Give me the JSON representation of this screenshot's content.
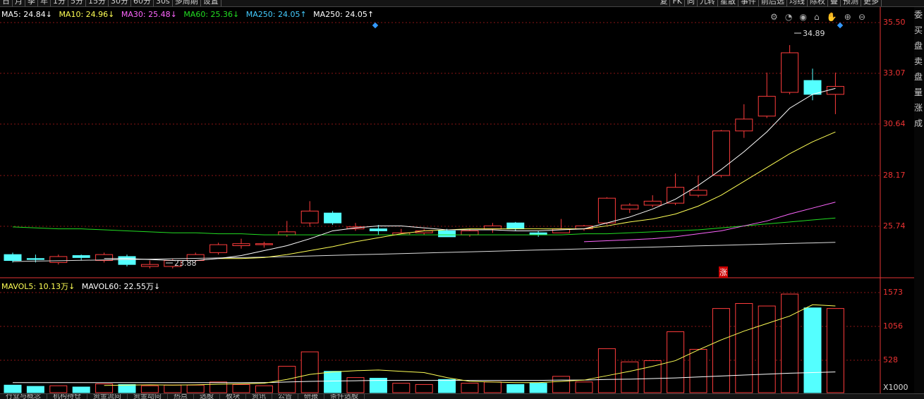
{
  "topbar": {
    "left_tabs": [
      "日",
      "月",
      "季",
      "年",
      "1分",
      "5分",
      "15分",
      "30分",
      "60分",
      "30s",
      "多周期",
      "设置"
    ],
    "right_tabs": [
      "复",
      "FK",
      "同",
      "九转",
      "星散",
      "事件",
      "前后选",
      "均线",
      "除权",
      "叠",
      "预测",
      "更多"
    ]
  },
  "ma_legend": {
    "ma5": "MA5: 24.84↓",
    "ma10": "MA10: 24.96↓",
    "ma30": "MA30: 25.48↓",
    "ma60": "MA60: 25.36↓",
    "ma250a": "MA250: 24.05↑",
    "ma250b": "MA250: 24.05↑"
  },
  "vol_legend": {
    "mavol5": "MAVOL5: 10.13万↓",
    "mavol60": "MAVOL60: 22.55万↓"
  },
  "axis": {
    "price_ticks": [
      "35.50",
      "33.07",
      "30.64",
      "28.17",
      "25.74"
    ],
    "vol_ticks": [
      "1573",
      "1056",
      "528",
      "X1000"
    ]
  },
  "annotations": {
    "high": "34.89",
    "low": "23.88",
    "zhang": "涨"
  },
  "sidepanel": [
    "委",
    "买",
    "盘",
    "卖",
    "盘",
    "量",
    "涨",
    "成"
  ],
  "bottombar": [
    "行业与概念",
    "机构持仓",
    "资金流向",
    "资金动向",
    "热点",
    "选股",
    "板块",
    "资讯",
    "公告",
    "研报",
    "条件选股"
  ],
  "colors": {
    "up": "#ff3c3c",
    "down": "#54ffff",
    "ma5": "#ffffff",
    "ma10": "#ffff55",
    "ma30": "#ff66ff",
    "ma60": "#22dd22",
    "ma250": "#dddddd",
    "axis": "#e33333"
  },
  "chart_data": {
    "type": "candlestick",
    "price_axis": {
      "min": 23.2,
      "max": 36.1
    },
    "volume_axis": {
      "max": 1650
    },
    "candles": [
      {
        "o": 24.3,
        "c": 24.0,
        "h": 24.4,
        "l": 23.9,
        "v": 120
      },
      {
        "o": 24.1,
        "c": 24.05,
        "h": 24.3,
        "l": 23.9,
        "v": 100
      },
      {
        "o": 23.9,
        "c": 24.2,
        "h": 24.3,
        "l": 23.8,
        "v": 110
      },
      {
        "o": 24.25,
        "c": 24.15,
        "h": 24.3,
        "l": 24.0,
        "v": 90
      },
      {
        "o": 24.0,
        "c": 24.3,
        "h": 24.4,
        "l": 23.9,
        "v": 140
      },
      {
        "o": 24.2,
        "c": 23.8,
        "h": 24.3,
        "l": 23.7,
        "v": 130
      },
      {
        "o": 23.7,
        "c": 23.8,
        "h": 24.0,
        "l": 23.6,
        "v": 110
      },
      {
        "o": 23.7,
        "c": 24.0,
        "h": 24.1,
        "l": 23.6,
        "v": 120
      },
      {
        "o": 24.0,
        "c": 24.3,
        "h": 24.4,
        "l": 23.9,
        "v": 120
      },
      {
        "o": 24.4,
        "c": 24.8,
        "h": 24.9,
        "l": 24.3,
        "v": 170
      },
      {
        "o": 24.75,
        "c": 24.85,
        "h": 25.1,
        "l": 24.6,
        "v": 130
      },
      {
        "o": 24.8,
        "c": 24.85,
        "h": 24.95,
        "l": 24.65,
        "v": 110
      },
      {
        "o": 25.3,
        "c": 25.45,
        "h": 26.0,
        "l": 25.2,
        "v": 420
      },
      {
        "o": 25.9,
        "c": 26.5,
        "h": 27.0,
        "l": 25.7,
        "v": 650
      },
      {
        "o": 26.4,
        "c": 25.9,
        "h": 26.5,
        "l": 25.8,
        "v": 340
      },
      {
        "o": 25.6,
        "c": 25.7,
        "h": 25.9,
        "l": 25.5,
        "v": 240
      },
      {
        "o": 25.6,
        "c": 25.5,
        "h": 25.8,
        "l": 25.3,
        "v": 230
      },
      {
        "o": 25.3,
        "c": 25.4,
        "h": 25.6,
        "l": 25.3,
        "v": 150
      },
      {
        "o": 25.4,
        "c": 25.5,
        "h": 25.6,
        "l": 25.3,
        "v": 130
      },
      {
        "o": 25.5,
        "c": 25.2,
        "h": 25.6,
        "l": 25.2,
        "v": 210
      },
      {
        "o": 25.3,
        "c": 25.5,
        "h": 25.6,
        "l": 25.2,
        "v": 150
      },
      {
        "o": 25.6,
        "c": 25.75,
        "h": 25.9,
        "l": 25.4,
        "v": 170
      },
      {
        "o": 25.9,
        "c": 25.6,
        "h": 25.95,
        "l": 25.5,
        "v": 130
      },
      {
        "o": 25.4,
        "c": 25.3,
        "h": 25.5,
        "l": 25.2,
        "v": 150
      },
      {
        "o": 25.4,
        "c": 25.6,
        "h": 26.1,
        "l": 25.4,
        "v": 260
      },
      {
        "o": 25.6,
        "c": 25.75,
        "h": 25.8,
        "l": 25.5,
        "v": 170
      },
      {
        "o": 25.9,
        "c": 27.15,
        "h": 27.2,
        "l": 25.8,
        "v": 700
      },
      {
        "o": 26.6,
        "c": 26.8,
        "h": 26.9,
        "l": 26.4,
        "v": 490
      },
      {
        "o": 26.8,
        "c": 27.0,
        "h": 27.3,
        "l": 26.7,
        "v": 510
      },
      {
        "o": 26.9,
        "c": 27.7,
        "h": 28.4,
        "l": 26.8,
        "v": 970
      },
      {
        "o": 27.3,
        "c": 27.55,
        "h": 28.3,
        "l": 27.2,
        "v": 690
      },
      {
        "o": 28.3,
        "c": 30.55,
        "h": 30.6,
        "l": 28.2,
        "v": 1340
      },
      {
        "o": 30.55,
        "c": 31.15,
        "h": 31.9,
        "l": 30.2,
        "v": 1420
      },
      {
        "o": 31.3,
        "c": 32.3,
        "h": 33.5,
        "l": 31.2,
        "v": 1380
      },
      {
        "o": 32.5,
        "c": 34.5,
        "h": 34.89,
        "l": 32.4,
        "v": 1570
      },
      {
        "o": 33.1,
        "c": 32.4,
        "h": 33.7,
        "l": 32.1,
        "v": 1350
      },
      {
        "o": 32.4,
        "c": 32.8,
        "h": 33.5,
        "l": 31.4,
        "v": 1340
      }
    ],
    "ma5": [
      null,
      null,
      null,
      null,
      24.1,
      24.1,
      24.05,
      24.0,
      24.0,
      24.1,
      24.25,
      24.5,
      24.75,
      25.1,
      25.5,
      25.65,
      25.75,
      25.75,
      25.65,
      25.55,
      25.55,
      25.55,
      25.5,
      25.5,
      25.55,
      25.6,
      25.9,
      26.2,
      26.6,
      27.1,
      27.8,
      28.6,
      29.5,
      30.5,
      31.7,
      32.4,
      32.7
    ],
    "ma10": [
      null,
      null,
      null,
      null,
      null,
      null,
      null,
      null,
      null,
      24.1,
      24.1,
      24.15,
      24.3,
      24.5,
      24.7,
      24.95,
      25.15,
      25.35,
      25.5,
      25.55,
      25.6,
      25.6,
      25.6,
      25.6,
      25.6,
      25.6,
      25.75,
      25.95,
      26.1,
      26.35,
      26.75,
      27.3,
      28.0,
      28.7,
      29.4,
      30.0,
      30.5
    ],
    "ma30": [
      null,
      null,
      null,
      null,
      null,
      null,
      null,
      null,
      null,
      null,
      null,
      null,
      null,
      null,
      null,
      null,
      null,
      null,
      null,
      null,
      null,
      null,
      null,
      null,
      null,
      24.95,
      25.0,
      25.05,
      25.1,
      25.2,
      25.35,
      25.5,
      25.75,
      26.0,
      26.35,
      26.65,
      26.95
    ],
    "ma60": [
      25.7,
      25.65,
      25.6,
      25.6,
      25.55,
      25.5,
      25.45,
      25.4,
      25.4,
      25.35,
      25.35,
      25.3,
      25.3,
      25.3,
      25.3,
      25.3,
      25.3,
      25.3,
      25.3,
      25.3,
      25.3,
      25.3,
      25.3,
      25.3,
      25.3,
      25.35,
      25.35,
      25.4,
      25.45,
      25.5,
      25.55,
      25.65,
      25.75,
      25.85,
      25.95,
      26.05,
      26.15
    ],
    "ma250": [
      23.95,
      23.97,
      23.99,
      24.01,
      24.03,
      24.05,
      24.07,
      24.09,
      24.11,
      24.13,
      24.15,
      24.17,
      24.2,
      24.23,
      24.26,
      24.29,
      24.32,
      24.35,
      24.38,
      24.41,
      24.44,
      24.47,
      24.5,
      24.53,
      24.56,
      24.59,
      24.62,
      24.65,
      24.68,
      24.71,
      24.74,
      24.77,
      24.8,
      24.83,
      24.86,
      24.89,
      24.92
    ],
    "mavol5": [
      null,
      null,
      null,
      null,
      115,
      120,
      125,
      120,
      125,
      135,
      140,
      150,
      210,
      290,
      330,
      350,
      360,
      340,
      320,
      240,
      180,
      170,
      160,
      160,
      180,
      200,
      270,
      340,
      420,
      510,
      680,
      840,
      980,
      1100,
      1220,
      1400,
      1380
    ],
    "mavol60": [
      160,
      160,
      160,
      160,
      160,
      160,
      160,
      160,
      160,
      160,
      160,
      160,
      170,
      180,
      185,
      190,
      195,
      195,
      195,
      195,
      195,
      195,
      195,
      195,
      200,
      200,
      210,
      215,
      225,
      235,
      250,
      265,
      280,
      295,
      310,
      320,
      330
    ]
  }
}
